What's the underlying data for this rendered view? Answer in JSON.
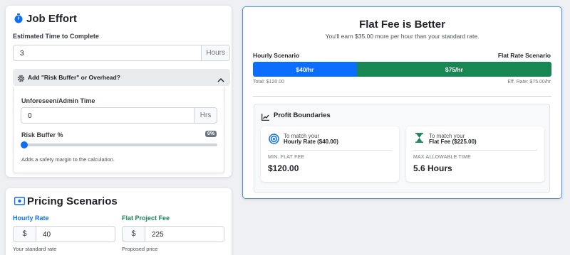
{
  "job_effort": {
    "title": "Job Effort",
    "time_label": "Estimated Time to Complete",
    "time_value": "3",
    "time_unit": "Hours",
    "accordion_title": "Add \"Risk Buffer\" or Overhead?",
    "admin_label": "Unforeseen/Admin Time",
    "admin_value": "0",
    "admin_unit": "Hrs",
    "risk_label": "Risk Buffer %",
    "risk_value": "0%",
    "risk_level": 0,
    "risk_help": "Adds a safety margin to the calculation."
  },
  "pricing": {
    "title": "Pricing Scenarios",
    "hourly_label": "Hourly Rate",
    "hourly_currency": "$",
    "hourly_value": "40",
    "hourly_help": "Your standard rate",
    "flat_label": "Flat Project Fee",
    "flat_currency": "$",
    "flat_value": "225",
    "flat_help": "Proposed price"
  },
  "result": {
    "headline": "Flat Fee is Better",
    "subline": "You'll earn $35.00 more per hour than your standard rate.",
    "hourly_scenario_label": "Hourly Scenario",
    "flat_scenario_label": "Flat Rate Scenario",
    "hourly_bar_label": "$40/hr",
    "flat_bar_label": "$75/hr",
    "hourly_share": 0.348,
    "flat_share": 0.652,
    "total_text": "Total: $120.00",
    "eff_rate_text": "Eff. Rate: $75.00/hr",
    "boundaries_title": "Profit Boundaries",
    "match_hourly_line1": "To match your",
    "match_hourly_line2": "Hourly Rate ($40.00)",
    "min_fee_caption": "MIN. FLAT FEE",
    "min_fee_value": "$120.00",
    "match_flat_line1": "To match your",
    "match_flat_line2": "Flat Fee ($225.00)",
    "max_time_caption": "MAX ALLOWABLE TIME",
    "max_time_value": "5.6 Hours"
  },
  "colors": {
    "primary": "#0d6efd",
    "success": "#198754",
    "accent_hourly_label": "#0d6efd",
    "accent_flat_label": "#198754"
  }
}
